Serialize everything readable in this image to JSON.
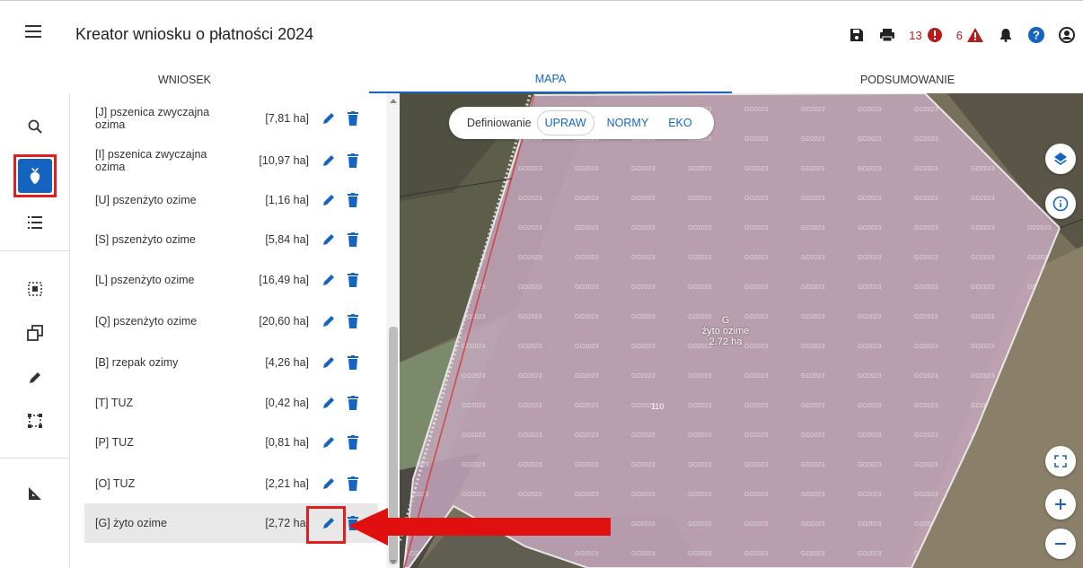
{
  "header": {
    "title": "Kreator wniosku o płatności 2024",
    "errors_count": "13",
    "warnings_count": "6",
    "icons": [
      "menu-icon",
      "save-icon",
      "print-icon",
      "error-icon",
      "warning-icon",
      "bell-icon",
      "help-icon",
      "account-icon"
    ]
  },
  "tabs": [
    {
      "label": "WNIOSEK",
      "active": false
    },
    {
      "label": "MAPA",
      "active": true
    },
    {
      "label": "PODSUMOWANIE",
      "active": false
    }
  ],
  "rail": {
    "icons": [
      "search-icon",
      "crop-icon",
      "list-icon",
      "select-region-icon",
      "copy-shape-icon",
      "pencil-icon",
      "bounding-box-icon",
      "measure-icon"
    ],
    "selected": "crop-icon"
  },
  "crops": [
    {
      "letter": "[J]",
      "name": "pszenica zwyczajna ozima",
      "area": "[7,81 ha]",
      "active": false
    },
    {
      "letter": "[I]",
      "name": "pszenica zwyczajna ozima",
      "area": "[10,97 ha]",
      "active": false
    },
    {
      "letter": "[U]",
      "name": "pszenżyto ozime",
      "area": "[1,16 ha]",
      "active": false
    },
    {
      "letter": "[S]",
      "name": "pszenżyto ozime",
      "area": "[5,84 ha]",
      "active": false
    },
    {
      "letter": "[L]",
      "name": "pszenżyto ozime",
      "area": "[16,49 ha]",
      "active": false
    },
    {
      "letter": "[Q]",
      "name": "pszenżyto ozime",
      "area": "[20,60 ha]",
      "active": false
    },
    {
      "letter": "[B]",
      "name": "rzepak ozimy",
      "area": "[4,26 ha]",
      "active": false
    },
    {
      "letter": "[T]",
      "name": "TUZ",
      "area": "[0,42 ha]",
      "active": false
    },
    {
      "letter": "[P]",
      "name": "TUZ",
      "area": "[0,81 ha]",
      "active": false
    },
    {
      "letter": "[O]",
      "name": "TUZ",
      "area": "[2,21 ha]",
      "active": false
    },
    {
      "letter": "[G]",
      "name": "żyto ozime",
      "area": "[2,72 ha]",
      "active": true
    }
  ],
  "map": {
    "definition_label": "Definiowanie",
    "chips": [
      "UPRAW",
      "NORMY",
      "EKO"
    ],
    "active_chip": "UPRAW",
    "watermark": "GO2023",
    "parcel": {
      "id": "G",
      "crop": "żyto ozime",
      "area": "2.72 ha",
      "number": "110"
    },
    "buttons": [
      "layers-icon",
      "info-icon",
      "fullscreen-icon",
      "zoom-in-icon",
      "zoom-out-icon"
    ]
  },
  "colors": {
    "accent": "#1565c0",
    "highlight": "#e02020",
    "error": "#b71c1c",
    "parcel_fill": "#c8a8c0"
  }
}
